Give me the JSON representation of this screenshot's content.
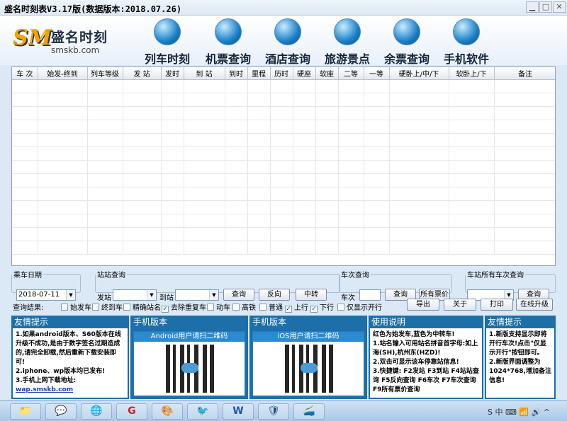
{
  "window": {
    "title": "盛名时刻表V3.17版(数据版本:2018.07.26)",
    "minimize": "▁",
    "maximize": "□",
    "close": "✕"
  },
  "brand": {
    "name": "盛名时刻",
    "site": "smskb.com",
    "logo_letters": "SM"
  },
  "nav": [
    {
      "label": "列车时刻",
      "icon": "train-icon"
    },
    {
      "label": "机票查询",
      "icon": "plane-icon"
    },
    {
      "label": "酒店查询",
      "icon": "hotel-icon"
    },
    {
      "label": "旅游景点",
      "icon": "scenic-icon"
    },
    {
      "label": "余票查询",
      "icon": "ticket-icon"
    },
    {
      "label": "手机软件",
      "icon": "mobile-icon"
    }
  ],
  "table": {
    "columns": [
      "车 次",
      "始发-终到",
      "列车等级",
      "发 站",
      "发时",
      "到 站",
      "到时",
      "里程",
      "历时",
      "硬座",
      "软座",
      "二等",
      "一等",
      "硬卧上/中/下",
      "软卧上/下",
      "备注"
    ]
  },
  "query": {
    "date_legend": "乘车日期",
    "date_value": "2018-07-11",
    "station_legend": "站站查询",
    "from_label": "发站",
    "to_label": "到站",
    "search_btn": "查询",
    "reverse_btn": "反向",
    "transfer_btn": "中转",
    "train_legend": "车次查询",
    "train_label": "车次",
    "train_search_btn": "查询",
    "all_price_btn": "所有票价",
    "all_trains_legend": "车站所有车次查询",
    "all_trains_btn": "查询"
  },
  "options": {
    "result_label": "查询结果:",
    "items": [
      {
        "label": "始发车",
        "checked": false
      },
      {
        "label": "终到车",
        "checked": false
      },
      {
        "label": "精确站名",
        "checked": false
      },
      {
        "label": "去除重复车",
        "checked": true
      },
      {
        "label": "动车",
        "checked": false
      },
      {
        "label": "高铁",
        "checked": false
      },
      {
        "label": "普通",
        "checked": false
      },
      {
        "label": "上行",
        "checked": true
      },
      {
        "label": "下行",
        "checked": true
      },
      {
        "label": "仅显示开行",
        "checked": false
      }
    ],
    "export_btn": "导出",
    "about_btn": "关于",
    "print_btn": "打印",
    "upgrade_btn": "在线升级"
  },
  "info": {
    "p1": {
      "title": "友情提示",
      "lines": [
        "1.如果android版本、S60版本在线升级不成功,是由于数字签名过期造成的,请完全卸载,然后重新下载安装即可!",
        "2.iphone、wp版本均已发布!",
        "3.手机上网下载地址:"
      ],
      "link": "wap.smskb.com"
    },
    "p2": {
      "title": "手机版本",
      "caption": "Android用户请扫二维码"
    },
    "p3": {
      "title": "手机版本",
      "caption": "iOS用户请扫二维码"
    },
    "p4": {
      "title": "使用说明",
      "lines": [
        "红色为始发车,蓝色为中转车!",
        "1.站名输入可用站名拼音首字母:如上海(SH),杭州东(HZD)!",
        "2.双击可显示该车停靠站信息!",
        "3.快捷键: F2发站 F3到站 F4站站查询 F5反向查询 F6车次 F7车次查询 F9所有票价查询"
      ]
    },
    "p5": {
      "title": "友情提示",
      "lines": [
        "1.新版支持显示即将开行车次!点击\"仅显示开行\"按钮即可。",
        "2.新版界面调整为1024*768,增加备注信息!"
      ]
    }
  },
  "taskbar": {
    "apps": [
      "📁",
      "💬",
      "🌐",
      "G",
      "🎨",
      "🐦",
      "W",
      "🛡",
      "🚄"
    ],
    "tray": "S 中 ⌨ 📶 🔊 ^"
  }
}
